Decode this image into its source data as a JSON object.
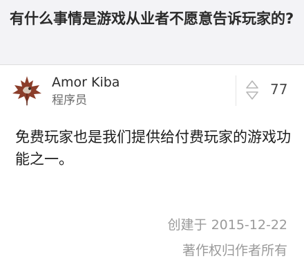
{
  "question": {
    "title": "有什么事情是游戏从业者不愿意告诉玩家的?"
  },
  "author": {
    "name": "Amor Kiba",
    "bio": "程序员",
    "avatar_icon": "maple-leaf-avatar-icon"
  },
  "vote": {
    "icon": "vote-arrows-icon",
    "count": "77"
  },
  "answer": {
    "text": "免费玩家也是我们提供给付费玩家的游戏功能之一。"
  },
  "footer": {
    "created": "创建于 2015-12-22",
    "copyright": "著作权归作者所有"
  },
  "colors": {
    "header_bg": "#f3f3f6",
    "muted_text": "#9a9a9a",
    "avatar_leaf": "#8b3d2a"
  }
}
